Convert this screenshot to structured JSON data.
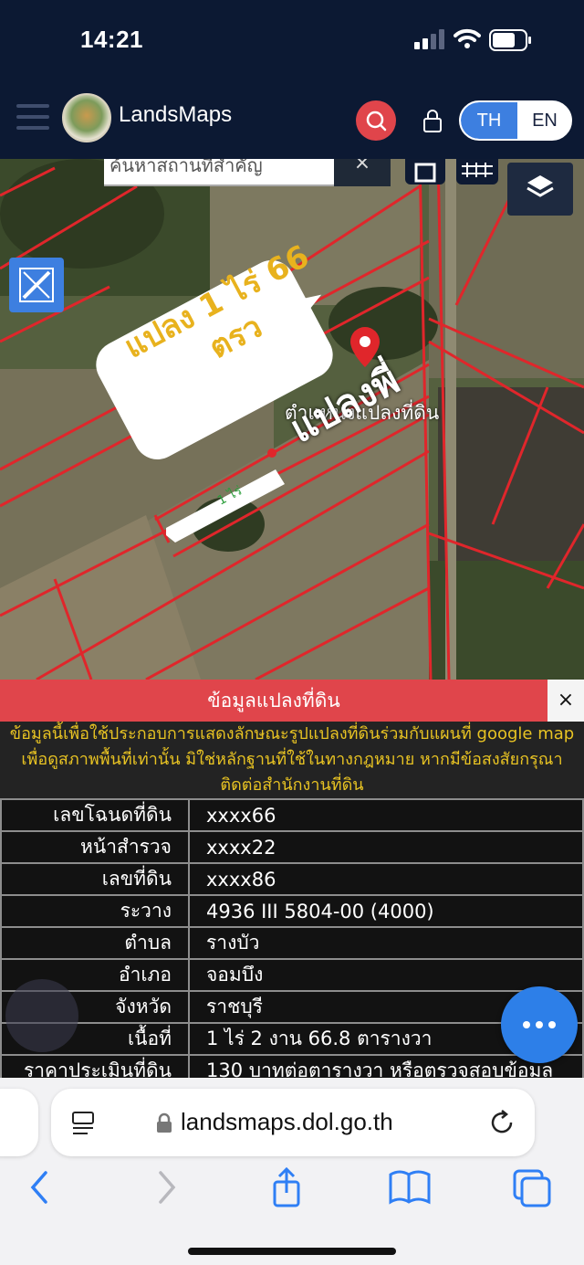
{
  "status_bar": {
    "time": "14:21"
  },
  "header": {
    "app_name": "LandsMaps",
    "lang_th": "TH",
    "lang_en": "EN"
  },
  "map": {
    "search_placeholder": "ค้นหาสถานที่สำคัญ",
    "search_clear": "×",
    "bubble_text": "แปลง 1 ไร่ 66 ตรว",
    "marker_label": "ตำแหน่งแปลงที่ดิน",
    "parcel_label": "แปลงพี่",
    "plot_area_label": "1 ไร่"
  },
  "info_panel": {
    "title": "ข้อมูลแปลงที่ดิน",
    "close": "×",
    "notice": "ข้อมูลนี้เพื่อใช้ประกอบการแสดงลักษณะรูปแปลงที่ดินร่วมกับแผนที่ google map เพื่อดูสภาพพื้นที่เท่านั้น มิใช่หลักฐานที่ใช้ในทางกฎหมาย หากมีข้อสงสัยกรุณาติดต่อสำนักงานที่ดิน",
    "rows": [
      {
        "label": "เลขโฉนดที่ดิน",
        "value": "xxxx66"
      },
      {
        "label": "หน้าสำรวจ",
        "value": "xxxx22"
      },
      {
        "label": "เลขที่ดิน",
        "value": "xxxx86"
      },
      {
        "label": "ระวาง",
        "value": "4936 III 5804-00 (4000)"
      },
      {
        "label": "ตำบล",
        "value": "รางบัว"
      },
      {
        "label": "อำเภอ",
        "value": "จอมบึง"
      },
      {
        "label": "จังหวัด",
        "value": "ราชบุรี"
      },
      {
        "label": "เนื้อที่",
        "value": "1 ไร่ 2 งาน 66.8 ตารางวา"
      },
      {
        "label": "ราคาประเมินที่ดิน",
        "value": "130 บาทต่อตารางวา หรือตรวจสอบข้อมูล"
      }
    ]
  },
  "browser": {
    "url": "landsmaps.dol.go.th"
  },
  "icons": {
    "menu": "hamburger-icon",
    "search": "search-icon",
    "lock": "lock-icon",
    "layers": "layers-icon",
    "measure": "ruler-pencil-icon",
    "more": "more-dots-icon",
    "reader": "reader-icon",
    "reload": "reload-icon",
    "back": "chevron-left-icon",
    "forward": "chevron-right-icon",
    "share": "share-icon",
    "bookmarks": "book-icon",
    "tabs": "tabs-icon"
  },
  "colors": {
    "header_bg": "#0c1933",
    "accent_red": "#e0454b",
    "accent_blue": "#3d7fe0",
    "notice_yellow": "#e8c323",
    "parcel_line": "#e0262b"
  }
}
